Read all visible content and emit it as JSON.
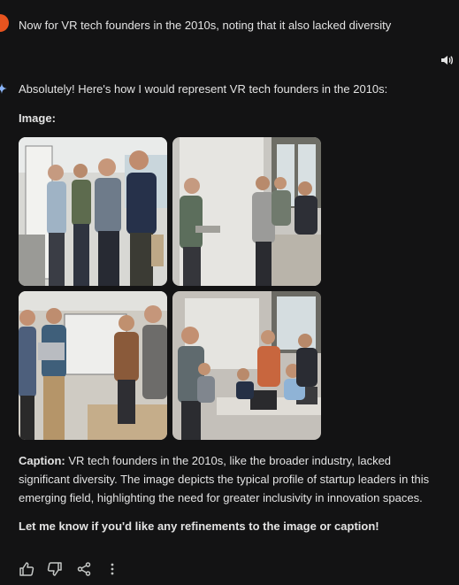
{
  "user": {
    "message": "Now for VR tech founders in the 2010s, noting that it also lacked diversity"
  },
  "response": {
    "intro": "Absolutely! Here's how I would represent VR tech founders in the 2010s:",
    "image_label": "Image:",
    "caption_label": "Caption:",
    "caption_text": " VR tech founders in the 2010s, like the broader industry, lacked significant diversity.  The image depicts the typical profile of startup leaders in this emerging field, highlighting the need for greater inclusivity in innovation spaces.",
    "closing": "Let me know if you'd like any refinements to the image or caption!",
    "images": [
      "generated-image-1",
      "generated-image-2",
      "generated-image-3",
      "generated-image-4"
    ]
  },
  "icons": {
    "speaker": "speaker-icon",
    "thumbs_up": "thumbs-up-icon",
    "thumbs_down": "thumbs-down-icon",
    "share": "share-icon",
    "more": "more-vert-icon"
  },
  "colors": {
    "background": "#131314",
    "text": "#e3e3e3",
    "avatar": "#e8541f"
  }
}
